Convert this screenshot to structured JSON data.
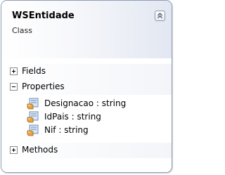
{
  "class": {
    "name": "WSEntidade",
    "stereotype": "Class"
  },
  "sections": {
    "fields": {
      "label": "Fields",
      "expanded": false
    },
    "properties": {
      "label": "Properties",
      "expanded": true,
      "items": [
        {
          "label": "Designacao : string",
          "icon": "property-icon"
        },
        {
          "label": "IdPais : string",
          "icon": "property-icon"
        },
        {
          "label": "Nif : string",
          "icon": "property-icon"
        }
      ]
    },
    "methods": {
      "label": "Methods",
      "expanded": false
    }
  },
  "colors": {
    "border": "#8e9db3",
    "header_gradient_end": "#e2e7f1",
    "property_icon_hand": "#e8a33c",
    "property_icon_sheet": "#d9e6f5"
  }
}
